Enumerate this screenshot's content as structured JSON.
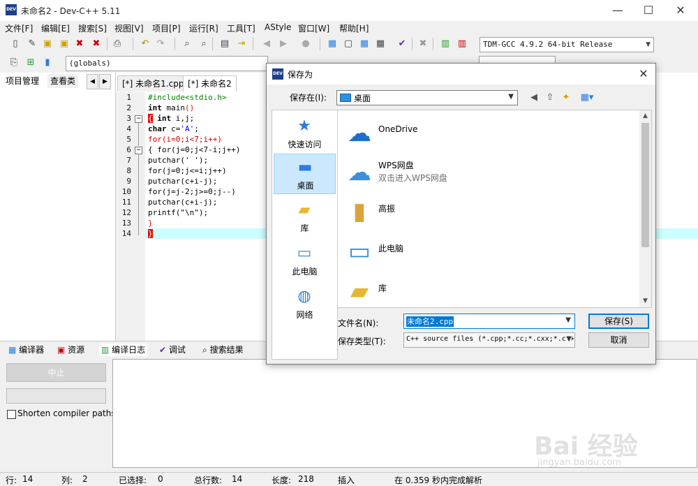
{
  "window": {
    "title": "未命名2 - Dev-C++ 5.11",
    "logo_text": "DEV C++",
    "controls": {
      "minimize": "—",
      "maximize": "☐",
      "close": "✕"
    }
  },
  "menu": [
    "文件[F]",
    "编辑[E]",
    "搜索[S]",
    "视图[V]",
    "项目[P]",
    "运行[R]",
    "工具[T]",
    "AStyle",
    "窗口[W]",
    "帮助[H]"
  ],
  "toolbar": {
    "compiler_select": "TDM-GCC 4.9.2 64-bit Release",
    "scope_select": "(globals)"
  },
  "left_panel": {
    "tabs": [
      "项目管理",
      "查看类"
    ]
  },
  "editor": {
    "tabs": [
      {
        "label": "[*] 未命名1.cpp",
        "active": false
      },
      {
        "label": "[*] 未命名2",
        "active": true
      }
    ],
    "line_numbers": [
      "1",
      "2",
      "3",
      "4",
      "5",
      "6",
      "7",
      "8",
      "9",
      "10",
      "11",
      "12",
      "13",
      "14"
    ],
    "fold_markers": [
      "−",
      "−"
    ],
    "lines": {
      "l1": "#include<stdio.h>",
      "l2_kw": "int",
      "l2_rest": " main",
      "l2_sym": "()",
      "l3_brace": "{",
      "l3_kw": " int",
      "l3_rest": " i,j;",
      "l4_kw": "char",
      "l4_rest": " c=",
      "l4_str": "'A'",
      "l4_end": ";",
      "l5": "for(i=0;i<7;i++)",
      "l6": "{ for(j=0;j<7-i;j++)",
      "l7": "putchar(' ');",
      "l8": "for(j=0;j<=i;j++)",
      "l9": "putchar(c+i-j);",
      "l10": "for(j=j-2;j>=0;j--)",
      "l11": "putchar(c+i-j);",
      "l12": "printf(\"\\n\");",
      "l13": "}",
      "l14": "}"
    }
  },
  "bottom_tabs": [
    "编译器",
    "资源",
    "编译日志",
    "调试",
    "搜索结果"
  ],
  "bottom_panel": {
    "stop_button": "中止",
    "shorten_label": "Shorten compiler paths"
  },
  "status": {
    "row_label": "行:",
    "row": "14",
    "col_label": "列:",
    "col": "2",
    "sel_label": "已选择:",
    "sel": "0",
    "total_label": "总行数:",
    "total": "14",
    "len_label": "长度:",
    "len": "218",
    "mode": "插入",
    "parse": "在 0.359 秒内完成解析"
  },
  "watermark": {
    "main": "Bai 经验",
    "sub": "jingyan.baidu.com"
  },
  "dialog": {
    "title": "保存为",
    "logo_text": "DEV C++",
    "close": "✕",
    "save_in_label": "保存在(I):",
    "save_in_value": "桌面",
    "places": [
      {
        "label": "快速访问",
        "icon": "star-icon"
      },
      {
        "label": "桌面",
        "icon": "desktop-icon"
      },
      {
        "label": "库",
        "icon": "library-icon"
      },
      {
        "label": "此电脑",
        "icon": "computer-icon"
      },
      {
        "label": "网络",
        "icon": "network-icon"
      }
    ],
    "files": [
      {
        "name": "OneDrive",
        "sub": "",
        "icon": "cloud-icon"
      },
      {
        "name": "WPS网盘",
        "sub": "双击进入WPS网盘",
        "icon": "cloud-outline-icon"
      },
      {
        "name": "高振",
        "sub": "",
        "icon": "user-folder-icon"
      },
      {
        "name": "此电脑",
        "sub": "",
        "icon": "computer-icon"
      },
      {
        "name": "库",
        "sub": "",
        "icon": "library-icon"
      }
    ],
    "filename_label": "文件名(N):",
    "filename_value": "未命名2.cpp",
    "filetype_label": "保存类型(T):",
    "filetype_value": "C++ source files (*.cpp;*.cc;*.cxx;*.c++;*.hpp;*.hh;*.hxx;*.h++)",
    "save_button": "保存(S)",
    "cancel_button": "取消"
  },
  "colors": {
    "accent": "#0078d7",
    "current_line": "#ccffff",
    "brace_highlight": "#ff0000"
  }
}
